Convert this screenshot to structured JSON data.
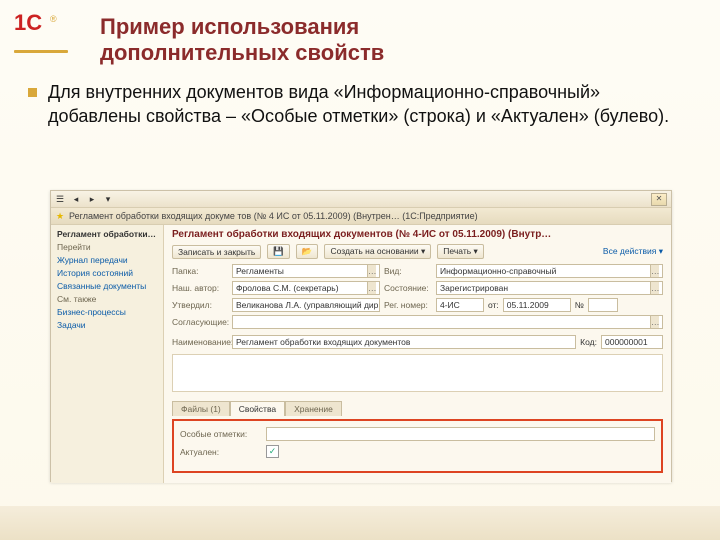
{
  "slide": {
    "title_l1": "Пример использования",
    "title_l2": "дополнительных свойств",
    "body": "Для внутренних документов вида «Информационно-справочный» добавлены свойства – «Особые отметки» (строка) и «Актуален» (булево)."
  },
  "window": {
    "doc_title": "Регламент обработки входящих докуме тов (№ 4 ИС от 05.11.2009) (Внутрен… (1С:Предприятие)",
    "star_icon": "★",
    "close_icon": "✕"
  },
  "sidebar": {
    "items": [
      "Регламент обработки…",
      "Перейти",
      "Журнал передачи",
      "История состояний",
      "Связанные документы",
      "См. также",
      "Бизнес-процессы",
      "Задачи"
    ]
  },
  "header": {
    "doc_heading": "Регламент обработки входящих документов (№ 4-ИС от 05.11.2009) (Внутр…"
  },
  "cmdbar": {
    "save_close": "Записать и закрыть",
    "create_by": "Создать на основании ▾",
    "print": "Печать ▾",
    "all_actions": "Все действия ▾",
    "icon_save": "💾",
    "icon_open": "📂"
  },
  "form": {
    "folder_lbl": "Папка:",
    "folder_val": "Регламенты",
    "kind_lbl": "Вид:",
    "kind_val": "Информационно-справочный",
    "author_lbl": "Наш. автор:",
    "author_val": "Фролова С.М. (секретарь)",
    "state_lbl": "Состояние:",
    "state_val": "Зарегистрирован",
    "approved_lbl": "Утвердил:",
    "approved_val": "Великанова Л.А. (управляющий дир…",
    "regnum_lbl": "Рег. номер:",
    "regnum_val": "4-ИС",
    "date_lbl": "от:",
    "date_val": "05.11.2009",
    "num_lbl": "№",
    "corr_lbl": "Согласующие:",
    "name_lbl": "Наименование:",
    "name_val": "Регламент обработки входящих документов",
    "code_lbl": "Код:",
    "code_val": "000000001",
    "sel": "…"
  },
  "tabs": {
    "files": "Файлы (1)",
    "props": "Свойства",
    "stor": "Хранение"
  },
  "props": {
    "marks_lbl": "Особые отметки:",
    "relevant_lbl": "Актуален:",
    "check": "✓"
  }
}
